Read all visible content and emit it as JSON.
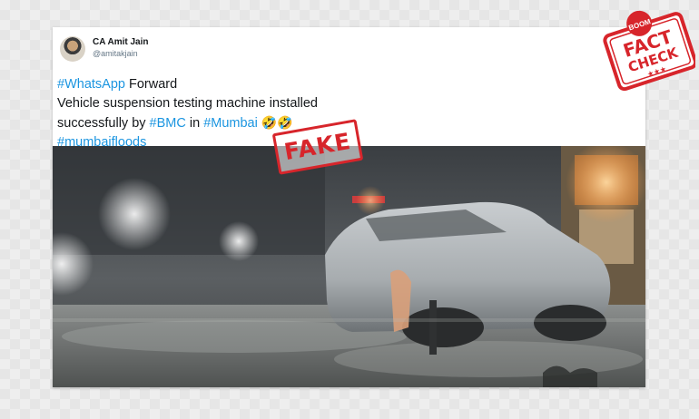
{
  "tweet": {
    "author_name": "CA Amit Jain",
    "author_handle": "@amitakjain",
    "line1_tag": "#WhatsApp",
    "line1_text": " Forward",
    "line2_text": "Vehicle suspension testing machine installed",
    "line3_text_a": "successfully by ",
    "line3_tag_a": "#BMC",
    "line3_text_b": " in ",
    "line3_tag_b": "#Mumbai",
    "line3_emoji": "🤣🤣",
    "line4_tag": "#mumbaifloods"
  },
  "overlay": {
    "fake_label": "FAKE",
    "badge_top": "BOOM",
    "badge_word1": "FACT",
    "badge_word2": "CHECK",
    "badge_stars": "★★★"
  },
  "colors": {
    "link": "#1b95e0",
    "stamp_red": "#d7252b"
  },
  "icons": [
    "avatar",
    "fact-check-badge-icon",
    "video-thumbnail"
  ]
}
